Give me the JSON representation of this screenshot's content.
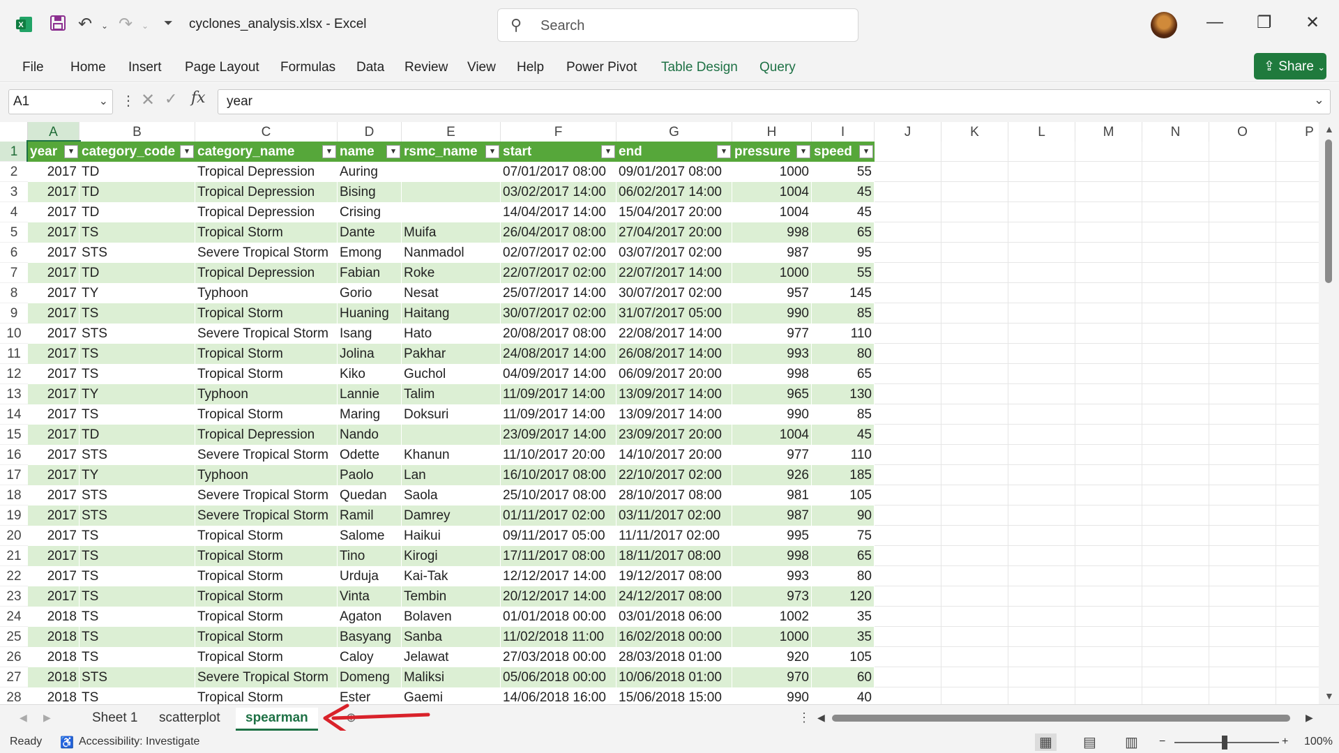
{
  "app": {
    "file_title": "cyclones_analysis.xlsx  -  Excel",
    "search_placeholder": "Search"
  },
  "menu": {
    "items": [
      "File",
      "Home",
      "Insert",
      "Page Layout",
      "Formulas",
      "Data",
      "Review",
      "View",
      "Help",
      "Power Pivot",
      "Table Design",
      "Query"
    ],
    "share_label": "Share"
  },
  "formula_bar": {
    "name_box": "A1",
    "formula": "year",
    "fx": "fx"
  },
  "columns": [
    "A",
    "B",
    "C",
    "D",
    "E",
    "F",
    "G",
    "H",
    "I",
    "J",
    "K",
    "L",
    "M",
    "N",
    "O",
    "P"
  ],
  "table": {
    "headers": [
      "year",
      "category_code",
      "category_name",
      "name",
      "rsmc_name",
      "start",
      "end",
      "pressure",
      "speed"
    ],
    "rows": [
      [
        "2017",
        "TD",
        "Tropical Depression",
        "Auring",
        "",
        "07/01/2017 08:00",
        "09/01/2017 08:00",
        "1000",
        "55"
      ],
      [
        "2017",
        "TD",
        "Tropical Depression",
        "Bising",
        "",
        "03/02/2017 14:00",
        "06/02/2017 14:00",
        "1004",
        "45"
      ],
      [
        "2017",
        "TD",
        "Tropical Depression",
        "Crising",
        "",
        "14/04/2017 14:00",
        "15/04/2017 20:00",
        "1004",
        "45"
      ],
      [
        "2017",
        "TS",
        "Tropical Storm",
        "Dante",
        "Muifa",
        "26/04/2017 08:00",
        "27/04/2017 20:00",
        "998",
        "65"
      ],
      [
        "2017",
        "STS",
        "Severe Tropical Storm",
        "Emong",
        "Nanmadol",
        "02/07/2017 02:00",
        "03/07/2017 02:00",
        "987",
        "95"
      ],
      [
        "2017",
        "TD",
        "Tropical Depression",
        "Fabian",
        "Roke",
        "22/07/2017 02:00",
        "22/07/2017 14:00",
        "1000",
        "55"
      ],
      [
        "2017",
        "TY",
        "Typhoon",
        "Gorio",
        "Nesat",
        "25/07/2017 14:00",
        "30/07/2017 02:00",
        "957",
        "145"
      ],
      [
        "2017",
        "TS",
        "Tropical Storm",
        "Huaning",
        "Haitang",
        "30/07/2017 02:00",
        "31/07/2017 05:00",
        "990",
        "85"
      ],
      [
        "2017",
        "STS",
        "Severe Tropical Storm",
        "Isang",
        "Hato",
        "20/08/2017 08:00",
        "22/08/2017 14:00",
        "977",
        "110"
      ],
      [
        "2017",
        "TS",
        "Tropical Storm",
        "Jolina",
        "Pakhar",
        "24/08/2017 14:00",
        "26/08/2017 14:00",
        "993",
        "80"
      ],
      [
        "2017",
        "TS",
        "Tropical Storm",
        "Kiko",
        "Guchol",
        "04/09/2017 14:00",
        "06/09/2017 20:00",
        "998",
        "65"
      ],
      [
        "2017",
        "TY",
        "Typhoon",
        "Lannie",
        "Talim",
        "11/09/2017 14:00",
        "13/09/2017 14:00",
        "965",
        "130"
      ],
      [
        "2017",
        "TS",
        "Tropical Storm",
        "Maring",
        "Doksuri",
        "11/09/2017 14:00",
        "13/09/2017 14:00",
        "990",
        "85"
      ],
      [
        "2017",
        "TD",
        "Tropical Depression",
        "Nando",
        "",
        "23/09/2017 14:00",
        "23/09/2017 20:00",
        "1004",
        "45"
      ],
      [
        "2017",
        "STS",
        "Severe Tropical Storm",
        "Odette",
        "Khanun",
        "11/10/2017 20:00",
        "14/10/2017 20:00",
        "977",
        "110"
      ],
      [
        "2017",
        "TY",
        "Typhoon",
        "Paolo",
        "Lan",
        "16/10/2017 08:00",
        "22/10/2017 02:00",
        "926",
        "185"
      ],
      [
        "2017",
        "STS",
        "Severe Tropical Storm",
        "Quedan",
        "Saola",
        "25/10/2017 08:00",
        "28/10/2017 08:00",
        "981",
        "105"
      ],
      [
        "2017",
        "STS",
        "Severe Tropical Storm",
        "Ramil",
        "Damrey",
        "01/11/2017 02:00",
        "03/11/2017 02:00",
        "987",
        "90"
      ],
      [
        "2017",
        "TS",
        "Tropical Storm",
        "Salome",
        "Haikui",
        "09/11/2017 05:00",
        "11/11/2017 02:00",
        "995",
        "75"
      ],
      [
        "2017",
        "TS",
        "Tropical Storm",
        "Tino",
        "Kirogi",
        "17/11/2017 08:00",
        "18/11/2017 08:00",
        "998",
        "65"
      ],
      [
        "2017",
        "TS",
        "Tropical Storm",
        "Urduja",
        "Kai-Tak",
        "12/12/2017 14:00",
        "19/12/2017 08:00",
        "993",
        "80"
      ],
      [
        "2017",
        "TS",
        "Tropical Storm",
        "Vinta",
        "Tembin",
        "20/12/2017 14:00",
        "24/12/2017 08:00",
        "973",
        "120"
      ],
      [
        "2018",
        "TS",
        "Tropical Storm",
        "Agaton",
        "Bolaven",
        "01/01/2018 00:00",
        "03/01/2018 06:00",
        "1002",
        "35"
      ],
      [
        "2018",
        "TS",
        "Tropical Storm",
        "Basyang",
        "Sanba",
        "11/02/2018 11:00",
        "16/02/2018 00:00",
        "1000",
        "35"
      ],
      [
        "2018",
        "TS",
        "Tropical Storm",
        "Caloy",
        "Jelawat",
        "27/03/2018 00:00",
        "28/03/2018 01:00",
        "920",
        "105"
      ],
      [
        "2018",
        "STS",
        "Severe Tropical Storm",
        "Domeng",
        "Maliksi",
        "05/06/2018 00:00",
        "10/06/2018 01:00",
        "970",
        "60"
      ],
      [
        "2018",
        "TS",
        "Tropical Storm",
        "Ester",
        "Gaemi",
        "14/06/2018 16:00",
        "15/06/2018 15:00",
        "990",
        "40"
      ]
    ]
  },
  "sheets": {
    "tabs": [
      "Sheet 1",
      "scatterplot",
      "spearman"
    ],
    "active": "spearman"
  },
  "status": {
    "ready": "Ready",
    "accessibility": "Accessibility: Investigate",
    "zoom": "100%"
  },
  "colors": {
    "header_green": "#56a73a",
    "band_green": "#dcefd4",
    "excel_green": "#1e7145",
    "arrow_red": "#d9222a"
  }
}
